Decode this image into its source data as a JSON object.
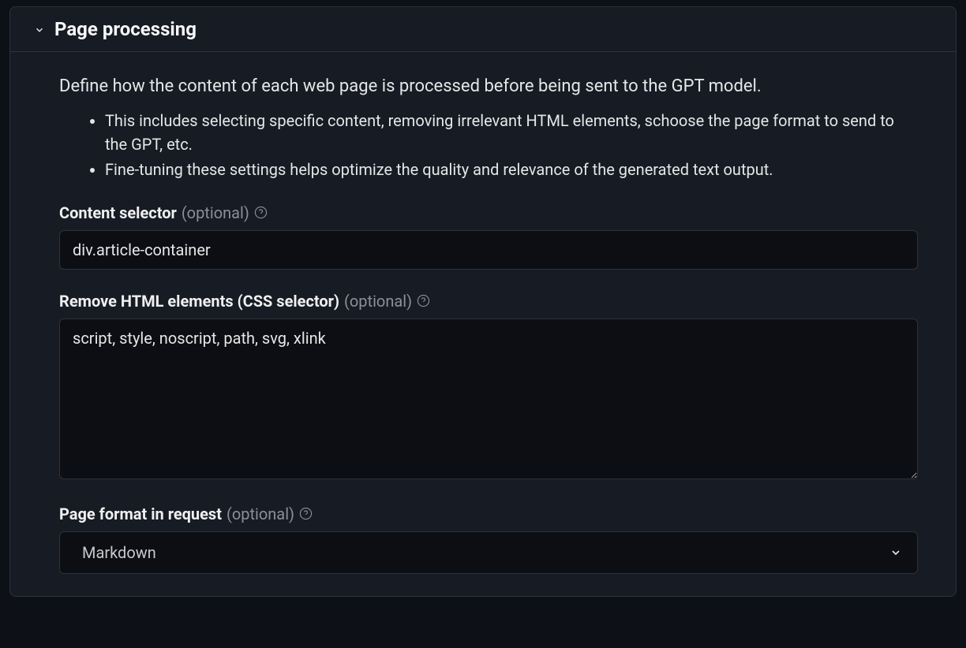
{
  "panel": {
    "title": "Page processing",
    "description": "Define how the content of each web page is processed before being sent to the GPT model.",
    "bullets": [
      "This includes selecting specific content, removing irrelevant HTML elements, schoose the page format to send to the GPT, etc.",
      "Fine-tuning these settings helps optimize the quality and relevance of the generated text output."
    ]
  },
  "fields": {
    "contentSelector": {
      "label": "Content selector",
      "optional": "(optional)",
      "value": "div.article-container"
    },
    "removeHtml": {
      "label": "Remove HTML elements (CSS selector)",
      "optional": "(optional)",
      "value": "script, style, noscript, path, svg, xlink"
    },
    "pageFormat": {
      "label": "Page format in request",
      "optional": "(optional)",
      "value": "Markdown"
    }
  }
}
